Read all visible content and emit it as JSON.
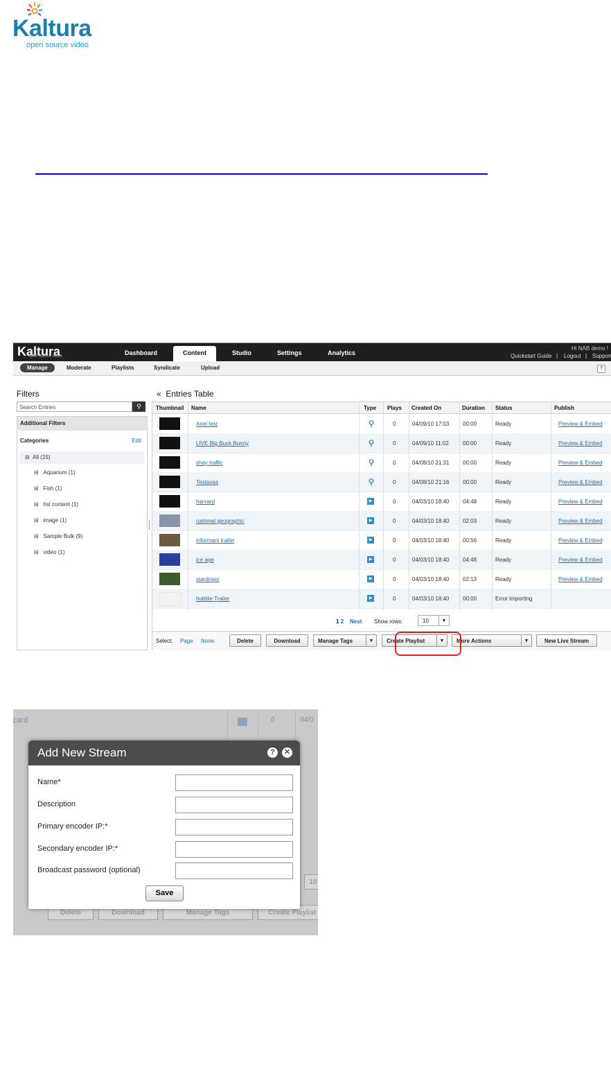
{
  "logo": {
    "brand": "Kaltura",
    "tagline": "open source video"
  },
  "kmc": {
    "brand": "Kaltura",
    "brand_sub": "open source video",
    "nav": [
      "Dashboard",
      "Content",
      "Studio",
      "Settings",
      "Analytics"
    ],
    "greeting": "Hi NAB demo !",
    "top_links": [
      "Quickstart Guide",
      "|",
      "Logout",
      "|",
      "Support"
    ],
    "subnav": [
      "Manage",
      "Moderate",
      "Playlists",
      "Syndicate",
      "Upload"
    ],
    "help": "?",
    "filters": {
      "title": "Filters",
      "search_placeholder": "Search Entries",
      "additional": "Additional Filters",
      "categories_label": "Categories",
      "edit": "Edit",
      "categories": [
        {
          "label": "All (15)",
          "expander": "⊟"
        },
        {
          "label": "Aquarium (1)",
          "expander": "⊟"
        },
        {
          "label": "Fish (1)",
          "expander": "⊟"
        },
        {
          "label": "hsl content (1)",
          "expander": "⊟"
        },
        {
          "label": "image (1)",
          "expander": "⊟"
        },
        {
          "label": "Sample Bulk (9)",
          "expander": "⊟"
        },
        {
          "label": "video (1)",
          "expander": "⊟"
        }
      ]
    },
    "entries": {
      "back": "«",
      "title": "Entries Table",
      "columns": [
        "Thumbnail",
        "Name",
        "Type",
        "Plays",
        "Created On",
        "Duration",
        "Status",
        "Publish"
      ],
      "rows": [
        {
          "name": "Ariel test",
          "type": "live",
          "plays": "0",
          "created": "04/09/10 17:03",
          "duration": "00:00",
          "status": "Ready",
          "publish": "Preview & Embed",
          "thumb": "dark"
        },
        {
          "name": "LIVE Big Buck Bunny",
          "type": "live",
          "plays": "0",
          "created": "04/09/10 11:02",
          "duration": "00:00",
          "status": "Ready",
          "publish": "Preview & Embed",
          "thumb": "dark"
        },
        {
          "name": "shay traffic",
          "type": "live",
          "plays": "0",
          "created": "04/08/10 21:31",
          "duration": "00:00",
          "status": "Ready",
          "publish": "Preview & Embed",
          "thumb": "dark"
        },
        {
          "name": "Testasaa",
          "type": "live",
          "plays": "0",
          "created": "04/08/10 21:16",
          "duration": "00:00",
          "status": "Ready",
          "publish": "Preview & Embed",
          "thumb": "dark"
        },
        {
          "name": "harvard",
          "type": "video",
          "plays": "0",
          "created": "04/03/10 18:40",
          "duration": "04:48",
          "status": "Ready",
          "publish": "Preview & Embed",
          "thumb": "dark"
        },
        {
          "name": "national geographic",
          "type": "video",
          "plays": "0",
          "created": "04/03/10 18:40",
          "duration": "02:03",
          "status": "Ready",
          "publish": "Preview & Embed",
          "thumb": "gray"
        },
        {
          "name": "informant trailer",
          "type": "video",
          "plays": "0",
          "created": "04/03/10 18:40",
          "duration": "00:56",
          "status": "Ready",
          "publish": "Preview & Embed",
          "thumb": "brown"
        },
        {
          "name": "ice age",
          "type": "video",
          "plays": "0",
          "created": "04/03/10 18:40",
          "duration": "04:48",
          "status": "Ready",
          "publish": "Preview & Embed",
          "thumb": "blue"
        },
        {
          "name": "stardnoor",
          "type": "video",
          "plays": "0",
          "created": "04/03/10 18:40",
          "duration": "02:13",
          "status": "Ready",
          "publish": "Preview & Embed",
          "thumb": "green"
        },
        {
          "name": "hubble Trailer",
          "type": "video",
          "plays": "0",
          "created": "04/03/10 18:40",
          "duration": "00:00",
          "status": "Error Importing",
          "publish": "",
          "thumb": "light"
        }
      ],
      "pager": {
        "p1": "1",
        "p2": "2",
        "next": "Next",
        "show_rows": "Show rows:",
        "rows_value": "10"
      },
      "actions": {
        "select": "Select:",
        "page": "Page",
        "none": "None",
        "delete": "Delete",
        "download": "Download",
        "manage_tags": "Manage Tags",
        "create_playlist": "Create Playlist",
        "more_actions": "More Actions",
        "new_live_stream": "New Live Stream"
      }
    }
  },
  "dialog_bg": {
    "values": [
      "0",
      "04/0"
    ],
    "buttons": [
      "Delete",
      "Download",
      "Manage Tags",
      "Create Playlist"
    ],
    "page_box": "10"
  },
  "dialog": {
    "title": "Add New Stream",
    "help": "?",
    "close": "✕",
    "fields": [
      "Name*",
      "Description",
      "Primary encoder IP:*",
      "Secondary encoder IP:*",
      "Broadcast password (optional)"
    ],
    "save": "Save"
  },
  "icons": {
    "live": "broadcast-antenna",
    "video": "video-clip",
    "search": "magnifier"
  }
}
